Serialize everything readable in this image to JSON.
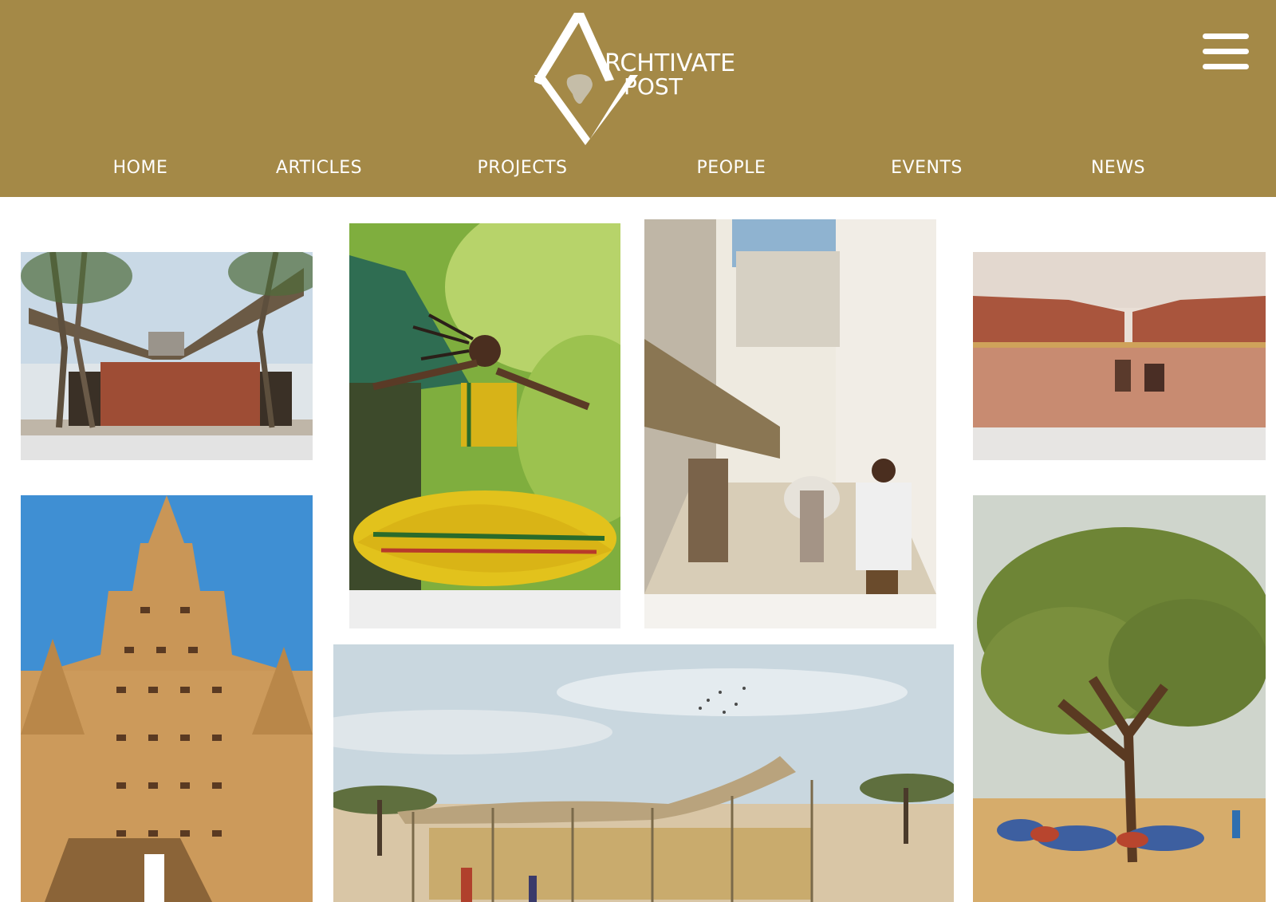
{
  "brand": {
    "logo_text_line1": "RCHTIVATE",
    "logo_text_line2": "POST",
    "color_header": "#a48947"
  },
  "header": {
    "menu_icon": "hamburger-menu-icon"
  },
  "nav": {
    "items": [
      {
        "label": "HOME"
      },
      {
        "label": "ARTICLES"
      },
      {
        "label": "PROJECTS"
      },
      {
        "label": "PEOPLE"
      },
      {
        "label": "EVENTS"
      },
      {
        "label": "NEWS"
      }
    ]
  }
}
